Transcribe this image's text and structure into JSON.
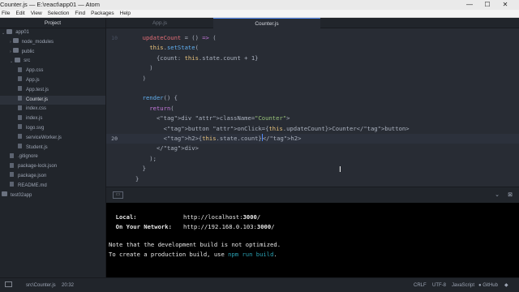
{
  "window": {
    "title": "Counter.js — E:\\react\\app01 — Atom",
    "controls": {
      "minimize": "—",
      "maximize": "☐",
      "close": "✕"
    }
  },
  "menu": [
    "File",
    "Edit",
    "View",
    "Selection",
    "Find",
    "Packages",
    "Help"
  ],
  "tree": {
    "header": "Project",
    "root": "app01",
    "items": [
      {
        "label": "node_modules",
        "kind": "folder",
        "chevron": "›"
      },
      {
        "label": "public",
        "kind": "folder",
        "chevron": "›"
      },
      {
        "label": "src",
        "kind": "folder",
        "chevron": "⌄"
      },
      {
        "label": "App.css",
        "kind": "file"
      },
      {
        "label": "App.js",
        "kind": "file"
      },
      {
        "label": "App.test.js",
        "kind": "file"
      },
      {
        "label": "Counter.js",
        "kind": "file",
        "selected": true
      },
      {
        "label": "index.css",
        "kind": "file"
      },
      {
        "label": "index.js",
        "kind": "file"
      },
      {
        "label": "logo.svg",
        "kind": "file"
      },
      {
        "label": "serviceWorker.js",
        "kind": "file"
      },
      {
        "label": "Student.js",
        "kind": "file"
      },
      {
        "label": ".gitignore",
        "kind": "file"
      },
      {
        "label": "package-lock.json",
        "kind": "file"
      },
      {
        "label": "package.json",
        "kind": "file"
      },
      {
        "label": "README.md",
        "kind": "file"
      }
    ],
    "second_root": "test02app",
    "root_chevron": "⌄"
  },
  "tabs": [
    {
      "label": "App.js",
      "active": false
    },
    {
      "label": "Counter.js",
      "active": true
    }
  ],
  "editor": {
    "lines": [
      {
        "n": "10",
        "text": "  updateCount = () => ("
      },
      {
        "n": "",
        "text": "    this.setState("
      },
      {
        "n": "",
        "text": "      {count: this.state.count + 1}"
      },
      {
        "n": "",
        "text": "    )"
      },
      {
        "n": "",
        "text": "  )"
      },
      {
        "n": "",
        "text": ""
      },
      {
        "n": "",
        "text": "  render() {"
      },
      {
        "n": "",
        "text": "    return("
      },
      {
        "n": "",
        "text": "      <div className=\"Counter\">"
      },
      {
        "n": "",
        "text": "        <button onClick={this.updateCount}>Counter</button>"
      },
      {
        "n": "20",
        "text": "        <h2>{this.state.count}</h2>"
      },
      {
        "n": "",
        "text": "      </div>"
      },
      {
        "n": "",
        "text": "    );"
      },
      {
        "n": "",
        "text": "  }"
      },
      {
        "n": "",
        "text": "}"
      }
    ],
    "cursor_line_number": "20"
  },
  "terminal": {
    "local_label": "  Local:",
    "local_url_prefix": "http://localhost:",
    "local_port": "3000",
    "local_url_suffix": "/",
    "network_label": "  On Your Network:",
    "network_url_prefix": "http://192.168.0.103:",
    "network_port": "3000",
    "network_url_suffix": "/",
    "note_line": "Note that the development build is not optimized.",
    "build_prefix": "To create a production build, use ",
    "build_cmd": "npm run build",
    "build_suffix": "."
  },
  "status": {
    "path": "src\\Counter.js",
    "position": "20:32",
    "line_ending": "CRLF",
    "encoding": "UTF-8",
    "grammar": "JavaScript",
    "github": "GitHub",
    "git": "Git (0)"
  },
  "colors": {
    "accent": "#568af2",
    "editor_bg": "#282c34",
    "panel_bg": "#21252b",
    "terminal_bg": "#000000"
  }
}
